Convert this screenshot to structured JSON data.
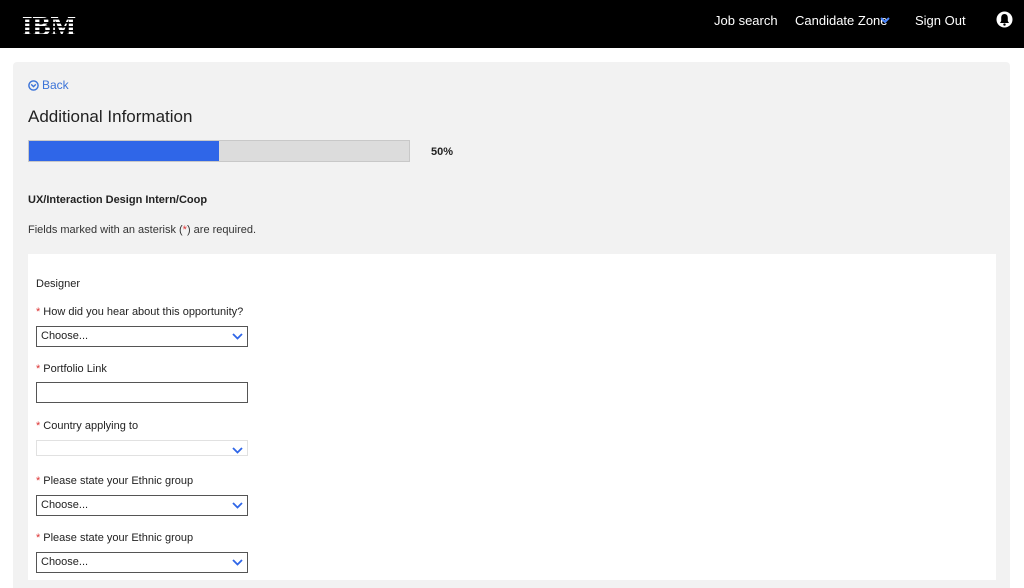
{
  "header": {
    "logo_text": "IBM",
    "nav": {
      "job_search": "Job search",
      "candidate_zone": "Candidate Zone",
      "sign_out": "Sign Out"
    },
    "icons": {
      "dropdown": "chevron-down-icon",
      "notifications": "bell-icon"
    }
  },
  "page": {
    "back_label": "Back",
    "title": "Additional Information",
    "progress": {
      "percent": 50,
      "label": "50%"
    },
    "job_title": "UX/Interaction Design Intern/Coop",
    "required_note": {
      "prefix": "Fields marked with an asterisk (",
      "asterisk": "*",
      "suffix": ") are required."
    }
  },
  "form": {
    "section": "Designer",
    "questions": [
      {
        "asterisk": "*",
        "label": "How did you hear about this opportunity?",
        "type": "select",
        "value": "Choose..."
      },
      {
        "asterisk": "*",
        "label": "Portfolio Link",
        "type": "text",
        "value": ""
      },
      {
        "asterisk": "*",
        "label": "Country applying to",
        "type": "select",
        "value": ""
      },
      {
        "asterisk": "*",
        "label": "Please state your Ethnic group",
        "type": "select",
        "value": "Choose..."
      },
      {
        "asterisk": "*",
        "label": "Please state your Ethnic group",
        "type": "select",
        "value": "Choose..."
      }
    ]
  },
  "colors": {
    "accent": "#2f66e8",
    "link": "#3b73d8",
    "required": "#dd3333",
    "header_bg": "#000000",
    "panel_bg": "#f2f2f2"
  }
}
